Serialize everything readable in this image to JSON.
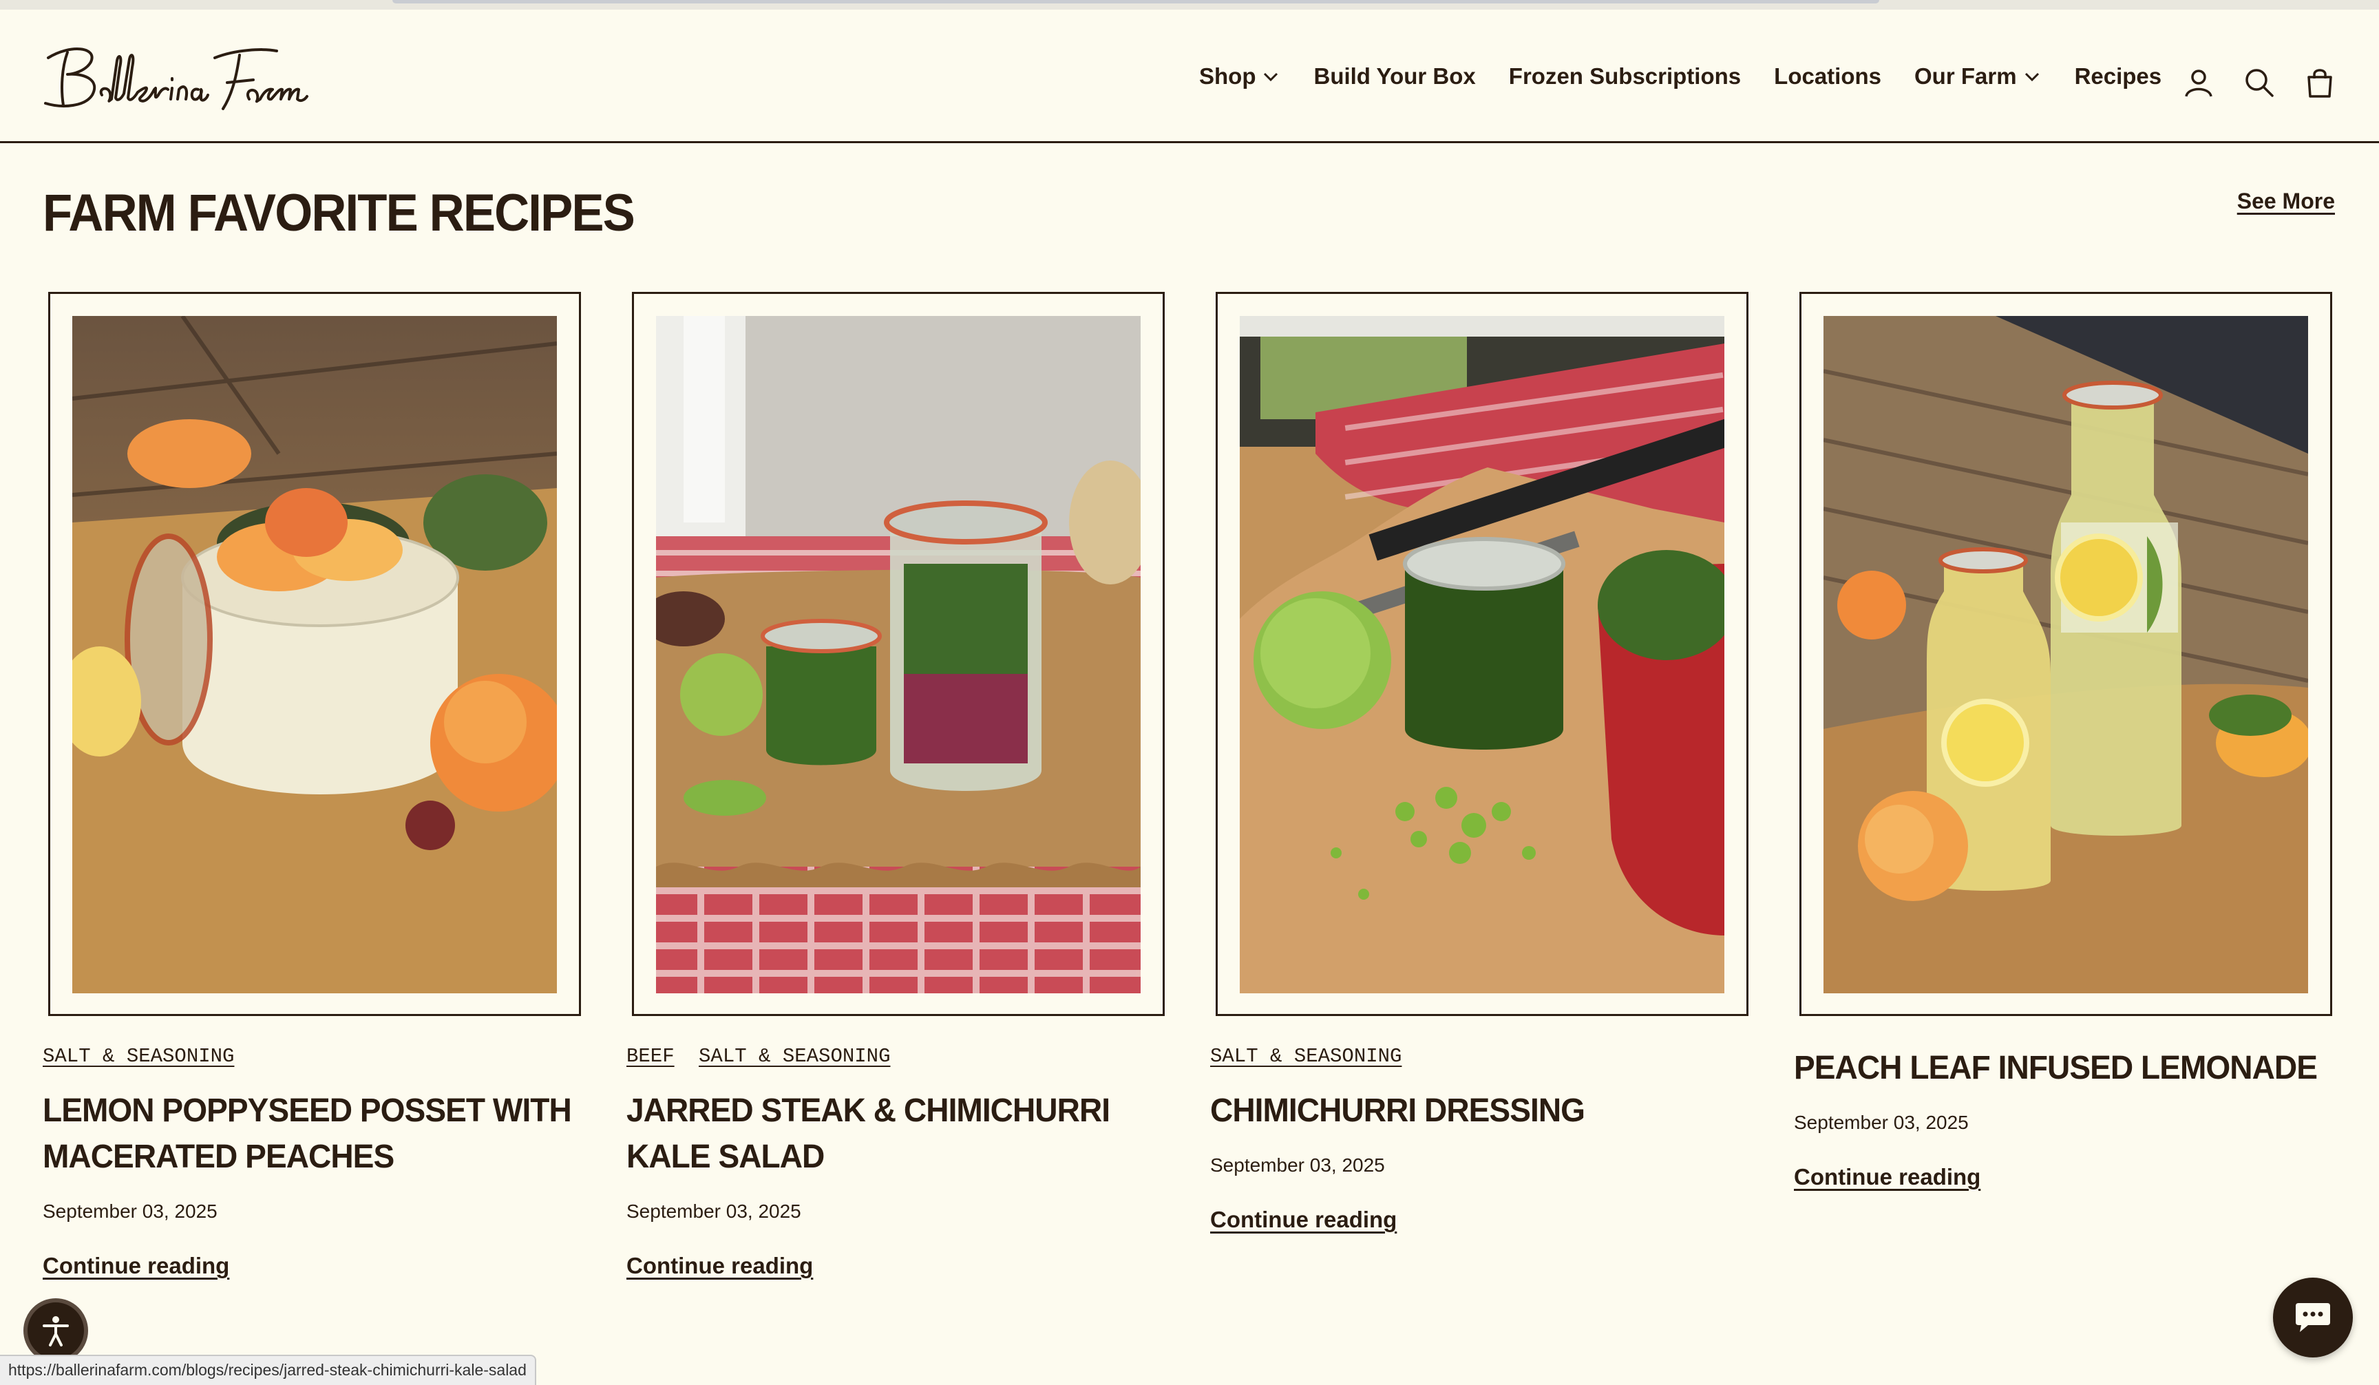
{
  "brand": {
    "logo_text": "Ballerina Farm"
  },
  "nav": {
    "items": [
      {
        "label": "Shop",
        "has_dropdown": true
      },
      {
        "label": "Build Your Box",
        "has_dropdown": false
      },
      {
        "label": "Frozen Subscriptions",
        "has_dropdown": false
      },
      {
        "label": "Locations",
        "has_dropdown": false
      },
      {
        "label": "Our Farm",
        "has_dropdown": true
      },
      {
        "label": "Recipes",
        "has_dropdown": false
      }
    ],
    "icons": [
      "account-icon",
      "search-icon",
      "cart-icon"
    ]
  },
  "section": {
    "title": "FARM FAVORITE RECIPES",
    "see_more": "See More"
  },
  "cards": [
    {
      "tags": [
        "SALT & SEASONING"
      ],
      "title": "LEMON POPPYSEED POSSET WITH MACERATED PEACHES",
      "date": "September 03, 2025",
      "link": "Continue reading",
      "photo": "peach-posset-jar-photo"
    },
    {
      "tags": [
        "BEEF",
        "SALT & SEASONING"
      ],
      "title": "JARRED STEAK & CHIMICHURRI KALE SALAD",
      "date": "September 03, 2025",
      "link": "Continue reading",
      "photo": "steak-salad-jars-photo"
    },
    {
      "tags": [
        "SALT & SEASONING"
      ],
      "title": "CHIMICHURRI DRESSING",
      "date": "September 03, 2025",
      "link": "Continue reading",
      "photo": "chimichurri-jar-photo"
    },
    {
      "tags": [],
      "title": "PEACH LEAF INFUSED LEMONADE",
      "date": "September 03, 2025",
      "link": "Continue reading",
      "photo": "lemonade-carafes-photo"
    }
  ],
  "status_bar": {
    "url": "https://ballerinafarm.com/blogs/recipes/jarred-steak-chimichurri-kale-salad"
  },
  "colors": {
    "background": "#fdfbef",
    "text": "#2b1d12"
  }
}
